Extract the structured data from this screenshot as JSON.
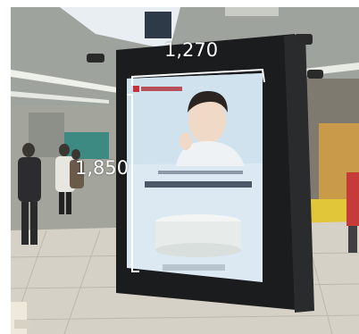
{
  "dimensions": {
    "width_label": "1,270",
    "height_label": "1,850"
  }
}
